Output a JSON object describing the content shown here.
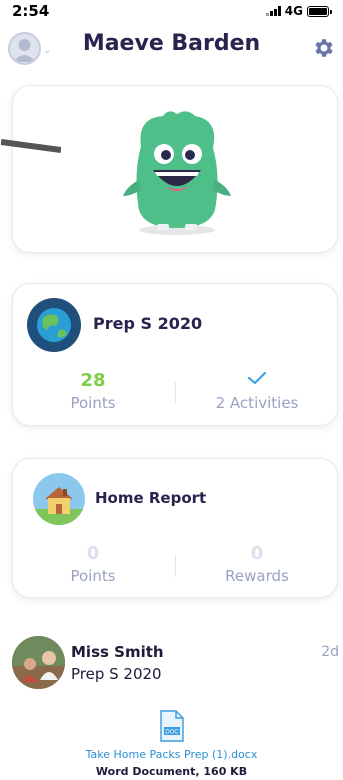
{
  "status_bar": {
    "time": "2:54",
    "network": "4G"
  },
  "header": {
    "title": "Maeve Barden",
    "avatar_icon": "user-avatar-icon",
    "settings_icon": "gear-icon"
  },
  "class_card": {
    "title": "Prep S 2020",
    "points_value": "28",
    "points_label": "Points",
    "activities_label": "2 Activities",
    "points_color": "#7ccf45",
    "check_color": "#3fa3e6"
  },
  "home_report": {
    "title": "Home Report",
    "points_value": "0",
    "points_label": "Points",
    "rewards_value": "0",
    "rewards_label": "Rewards"
  },
  "post": {
    "author": "Miss Smith",
    "class_name": "Prep S 2020",
    "time": "2d"
  },
  "attachment": {
    "icon_label": "DOC",
    "file_name": "Take Home Packs Prep (1).docx",
    "file_meta": "Word Document, 160 KB"
  }
}
